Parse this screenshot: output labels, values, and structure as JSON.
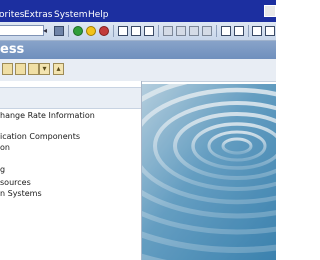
{
  "menubar": {
    "items": [
      "orites",
      "Extras",
      "System",
      "Help"
    ]
  },
  "toolbar": {
    "command_field_value": "",
    "icons": [
      "enter-icon",
      "save-icon",
      "back-icon",
      "exit-icon",
      "cancel-icon",
      "print-icon",
      "find-icon",
      "find-next-icon",
      "first-page-icon",
      "previous-page-icon",
      "next-page-icon",
      "last-page-icon",
      "new-session-icon",
      "shortcut-icon",
      "help-icon"
    ]
  },
  "titlebar": {
    "title": "ess"
  },
  "apptoolbar": {
    "icons": [
      "other-menu-icon",
      "add-favorites-icon",
      "edit-icon",
      "expand-icon",
      "collapse-icon"
    ]
  },
  "tree": {
    "items": [
      "hange Rate Information",
      "ication Components",
      "on",
      "g",
      "sources",
      "n Systems"
    ]
  },
  "colors": {
    "menubar": "#1c2fa0",
    "titlebar": "#7a97c3",
    "image_water": "#4d8fb8"
  }
}
